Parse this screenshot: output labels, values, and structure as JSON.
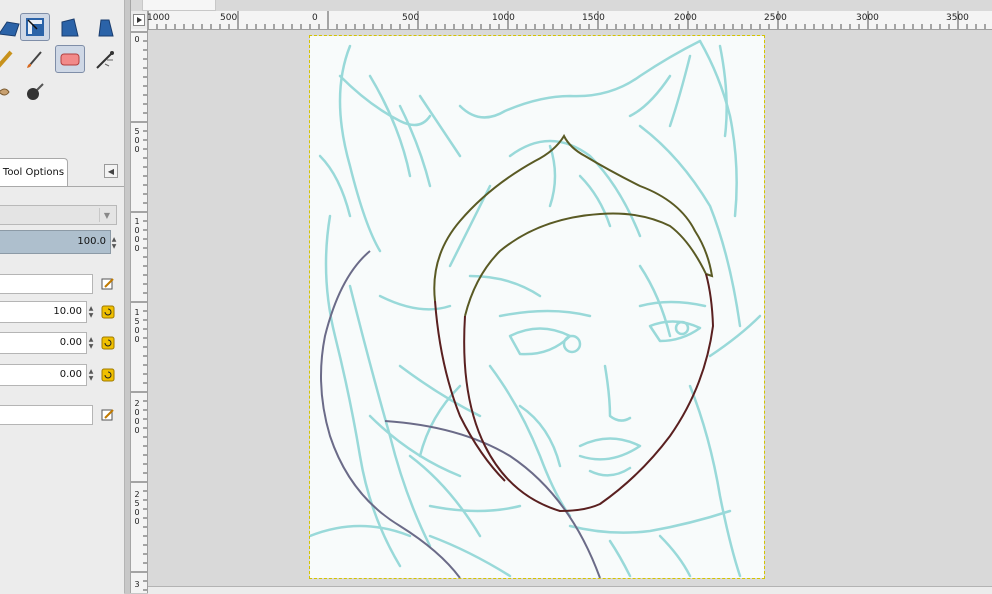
{
  "toolbox": {
    "tools": [
      {
        "name": "perspective-tool",
        "icon": "perspective-icon"
      },
      {
        "name": "scale-tool",
        "icon": "scale-icon",
        "active": true
      },
      {
        "name": "shear-tool",
        "icon": "shear-icon"
      },
      {
        "name": "flip-tool",
        "icon": "flip-icon"
      },
      {
        "name": "pencil-tool",
        "icon": "pencil-icon"
      },
      {
        "name": "paintbrush-tool",
        "icon": "paintbrush-icon"
      },
      {
        "name": "eraser-tool",
        "icon": "eraser-icon",
        "active": true
      },
      {
        "name": "airbrush-tool",
        "icon": "airbrush-icon"
      },
      {
        "name": "smudge-tool",
        "icon": "smudge-icon"
      },
      {
        "name": "dodge-burn-tool",
        "icon": "dodge-burn-icon"
      }
    ]
  },
  "dock": {
    "tab_label": "Tool Options"
  },
  "tool_options": {
    "opacity_value": "100.0",
    "size_value": "10.00",
    "aspect_value": "0.00",
    "angle_value": "0.00"
  },
  "rulers": {
    "horizontal_labels": [
      "1000",
      "500",
      "0",
      "500",
      "1000",
      "1500",
      "2000",
      "2500",
      "3000",
      "3500"
    ],
    "vertical_labels": [
      "0",
      "500",
      "1000",
      "1500",
      "2000",
      "2500",
      "3"
    ]
  },
  "colors": {
    "sketch": "#8fd6d6",
    "hood_outline": "#5a5a24",
    "face_outline": "#5a2020",
    "cape_outline": "#6b6b88"
  }
}
